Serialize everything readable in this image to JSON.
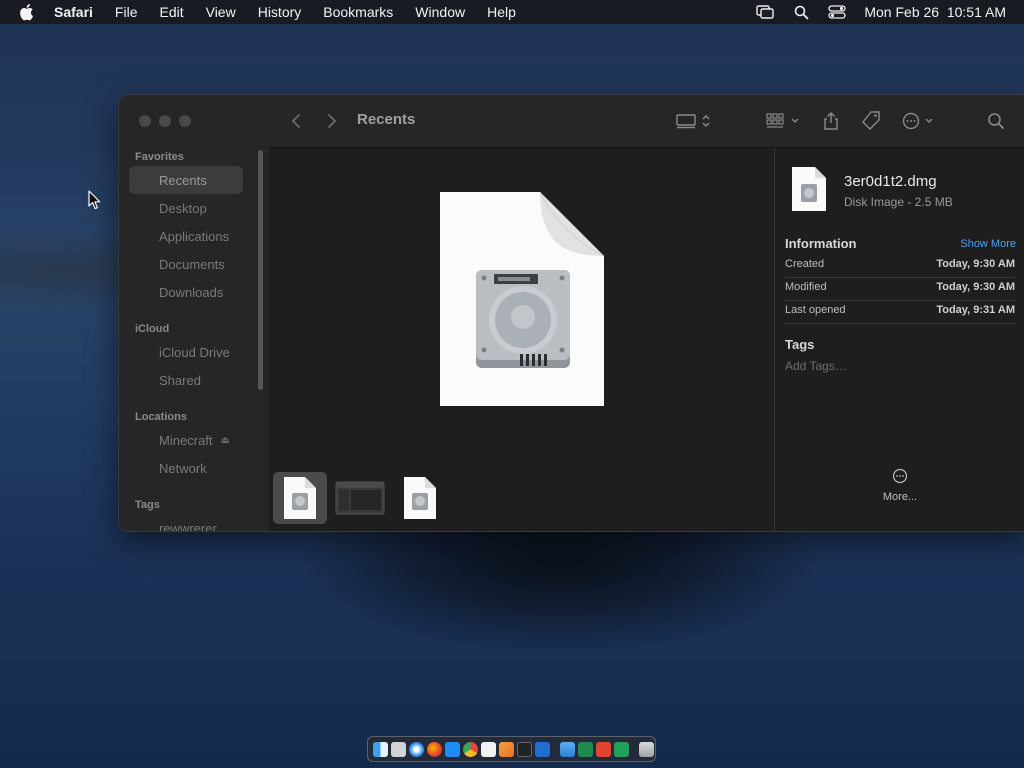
{
  "menubar": {
    "app_name": "Safari",
    "menus": [
      "File",
      "Edit",
      "View",
      "History",
      "Bookmarks",
      "Window",
      "Help"
    ],
    "clock": "Mon Feb 26  10:51 AM",
    "icons": [
      "screen-mirroring-icon",
      "spotlight-search-icon",
      "control-center-icon"
    ]
  },
  "finder": {
    "title": "Recents",
    "sidebar": {
      "favorites_header": "Favorites",
      "favorites": [
        "Recents",
        "Desktop",
        "Applications",
        "Documents",
        "Downloads"
      ],
      "icloud_header": "iCloud",
      "icloud": [
        "iCloud Drive",
        "Shared"
      ],
      "locations_header": "Locations",
      "locations": [
        "Minecraft",
        "Network"
      ],
      "tags_header": "Tags",
      "tags": [
        "rewwrerer"
      ]
    },
    "inspector": {
      "file_name": "3er0d1t2.dmg",
      "file_kind": "Disk Image - 2.5 MB",
      "information_header": "Information",
      "show_more": "Show More",
      "rows": [
        {
          "label": "Created",
          "value": "Today, 9:30 AM"
        },
        {
          "label": "Modified",
          "value": "Today, 9:30 AM"
        },
        {
          "label": "Last opened",
          "value": "Today, 9:31 AM"
        }
      ],
      "tags_header": "Tags",
      "add_tags_placeholder": "Add Tags…",
      "more_label": "More..."
    }
  },
  "colors": {
    "accent_link": "#4aa3ff",
    "window_bg": "#1e1e1e",
    "sidebar_bg": "#262626"
  }
}
